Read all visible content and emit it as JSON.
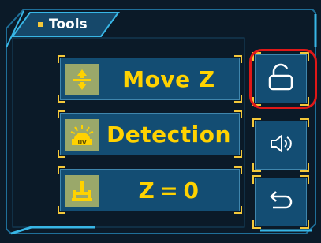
{
  "panel": {
    "title": "Tools"
  },
  "tools": [
    {
      "label": "Move Z",
      "icon": "up-down-arrows-icon"
    },
    {
      "label": "Detection",
      "icon": "uv-lamp-icon"
    },
    {
      "label": "Z = 0",
      "icon": "z-home-icon"
    }
  ],
  "side_buttons": [
    {
      "icon": "unlock-icon",
      "highlighted": true
    },
    {
      "icon": "speaker-icon",
      "highlighted": false
    },
    {
      "icon": "back-icon",
      "highlighted": false
    }
  ],
  "colors": {
    "accent": "#f4c83a",
    "label": "#ffd200",
    "button_bg": "#134d73",
    "highlight": "#e01818",
    "frame": "#38b6e6"
  }
}
